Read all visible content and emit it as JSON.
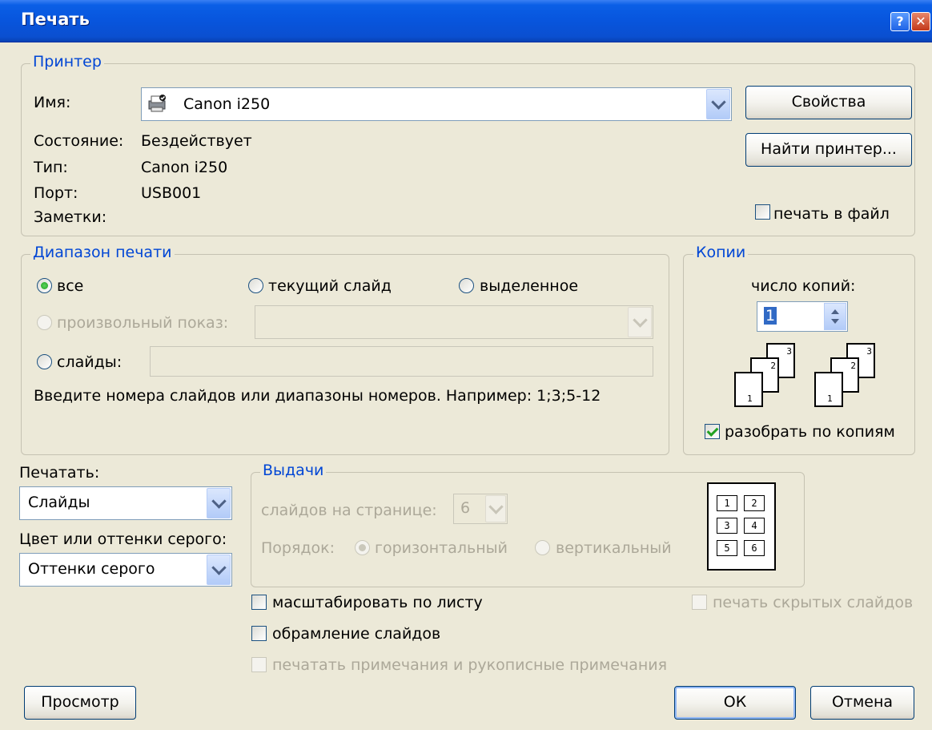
{
  "window": {
    "title": "Печать",
    "help": "?",
    "close": "✕"
  },
  "printer": {
    "legend": "Принтер",
    "name_label": "Имя:",
    "name_value": "Canon i250",
    "status_label": "Состояние:",
    "status_value": "Бездействует",
    "type_label": "Тип:",
    "type_value": "Canon i250",
    "port_label": "Порт:",
    "port_value": "USB001",
    "notes_label": "Заметки:",
    "properties_button": "Свойства",
    "find_button": "Найти принтер...",
    "print_to_file": "печать в файл"
  },
  "range": {
    "legend": "Диапазон печати",
    "all": "все",
    "current_slide": "текущий слайд",
    "selection": "выделенное",
    "custom_show": "произвольный показ:",
    "slides": "слайды:",
    "hint": "Введите номера слайдов или диапазоны номеров. Например: 1;3;5-12"
  },
  "copies": {
    "legend": "Копии",
    "count_label": "число копий:",
    "count_value": "1",
    "collate": "разобрать по копиям"
  },
  "print_what": {
    "label": "Печатать:",
    "value": "Слайды",
    "color_label": "Цвет или оттенки серого:",
    "color_value": "Оттенки серого"
  },
  "handouts": {
    "legend": "Выдачи",
    "per_page_label": "слайдов на странице:",
    "per_page_value": "6",
    "order_label": "Порядок:",
    "horizontal": "горизонтальный",
    "vertical": "вертикальный"
  },
  "options": {
    "scale_to_fit": "масштабировать по листу",
    "frame_slides": "обрамление слайдов",
    "print_comments": "печатать примечания и рукописные примечания",
    "print_hidden": "печать скрытых слайдов"
  },
  "buttons": {
    "preview": "Просмотр",
    "ok": "ОК",
    "cancel": "Отмена"
  },
  "preview_numbers": [
    "1",
    "2",
    "3"
  ],
  "handout_cells": [
    "1",
    "2",
    "3",
    "4",
    "5",
    "6"
  ]
}
